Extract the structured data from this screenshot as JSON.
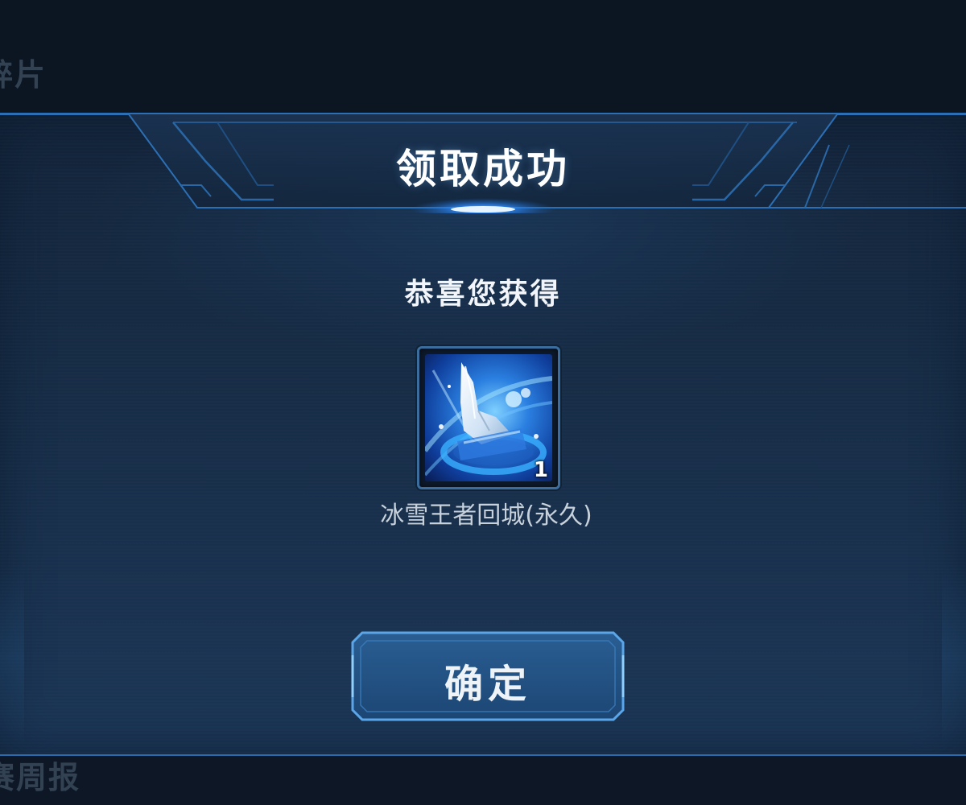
{
  "background": {
    "top_text": "碎片",
    "bottom_text": "赛周报"
  },
  "dialog": {
    "title": "领取成功",
    "subtitle": "恭喜您获得",
    "reward": {
      "name": "冰雪王者回城(永久)",
      "count": "1",
      "icon": "ice-king-recall-effect-icon"
    },
    "confirm_label": "确定"
  },
  "colors": {
    "accent": "#2c8cff",
    "frame_border": "#3b6e9f",
    "panel_dark": "#13243a",
    "panel_light": "#1b3656"
  }
}
